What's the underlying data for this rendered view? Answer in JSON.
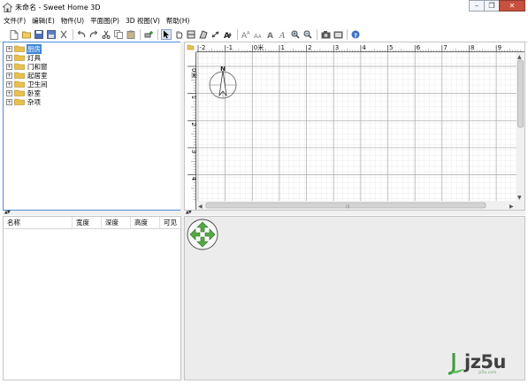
{
  "window": {
    "title": "未命名 - Sweet Home 3D",
    "minimize_glyph": "–",
    "restore_glyph": "❐",
    "close_glyph": "✕"
  },
  "menu": {
    "items": [
      "文件(F)",
      "编辑(E)",
      "物件(U)",
      "平面图(P)",
      "3D 视图(V)",
      "帮助(H)"
    ]
  },
  "toolbar": {
    "icons": [
      "new-home-icon",
      "open-icon",
      "save-icon",
      "save-as-icon",
      "cut-icon",
      "undo-icon",
      "redo-icon",
      "cut-scissors-icon",
      "copy-icon",
      "paste-icon",
      "add-furniture-icon",
      "select-mode-icon",
      "pan-mode-icon",
      "create-walls-icon",
      "create-rooms-icon",
      "create-dimensions-icon",
      "add-text-icon",
      "increase-text-size-icon",
      "decrease-text-size-icon",
      "bold-text-icon",
      "italic-text-icon",
      "zoom-in-icon",
      "zoom-out-icon",
      "create-photo-icon",
      "create-video-icon",
      "help-icon"
    ]
  },
  "catalog": {
    "expand_glyph": "+",
    "categories": [
      {
        "label": "厨房",
        "selected": true
      },
      {
        "label": "灯具",
        "selected": false
      },
      {
        "label": "门和窗",
        "selected": false
      },
      {
        "label": "起居室",
        "selected": false
      },
      {
        "label": "卫生间",
        "selected": false
      },
      {
        "label": "卧室",
        "selected": false
      },
      {
        "label": "杂项",
        "selected": false
      }
    ]
  },
  "furniture_table": {
    "columns": [
      "名称",
      "宽度",
      "深度",
      "高度",
      "可见"
    ]
  },
  "plan": {
    "x_ruler_labels": [
      "-2",
      "-1",
      "0米",
      "1",
      "2",
      "3",
      "4",
      "5",
      "6",
      "7",
      "8",
      "9"
    ],
    "y_ruler_labels": [
      "0米",
      "1",
      "2",
      "3",
      "4"
    ],
    "compass_label": "N",
    "scroll_left_arrow": "◀",
    "scroll_right_arrow": "▶",
    "scroll_up_arrow": "▲",
    "scroll_down_arrow": "▼",
    "scroll_grip": "|||"
  },
  "splitter": {
    "arrows": "▲▼"
  },
  "watermark": {
    "brand": "jz5u",
    "sub": "jz5u.com"
  },
  "colors": {
    "selection": "#3d84d9",
    "folder": "#e8c14a",
    "navigator_arrows": "#55a845",
    "plan_grid": "#d3d3d3"
  }
}
